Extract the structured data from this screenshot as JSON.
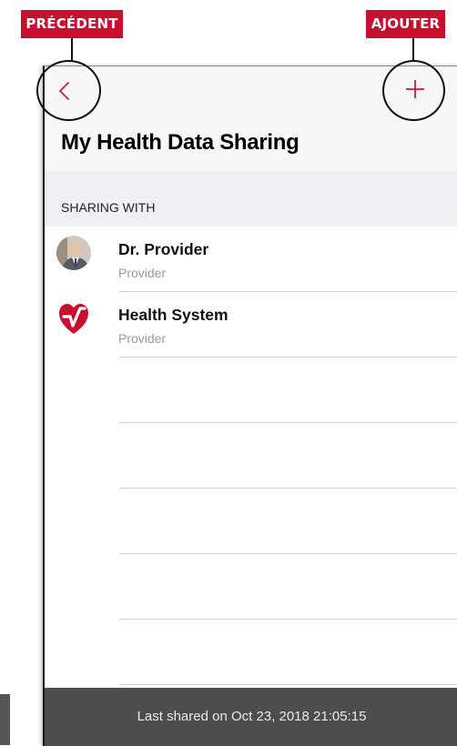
{
  "callouts": {
    "back_label": "PRÉCÉDENT",
    "add_label": "AJOUTER"
  },
  "header": {
    "title": "My Health Data Sharing"
  },
  "section": {
    "label": "SHARING WITH"
  },
  "sharing_list": [
    {
      "name": "Dr. Provider",
      "role": "Provider",
      "avatar": "person-photo"
    },
    {
      "name": "Health System",
      "role": "Provider",
      "avatar": "health-system-logo"
    }
  ],
  "footer": {
    "text": "Last shared on Oct 23, 2018 21:05:15"
  },
  "colors": {
    "accent": "#d11b33",
    "tag_red": "#c8102e",
    "footer_bg": "#4d4d4d"
  }
}
